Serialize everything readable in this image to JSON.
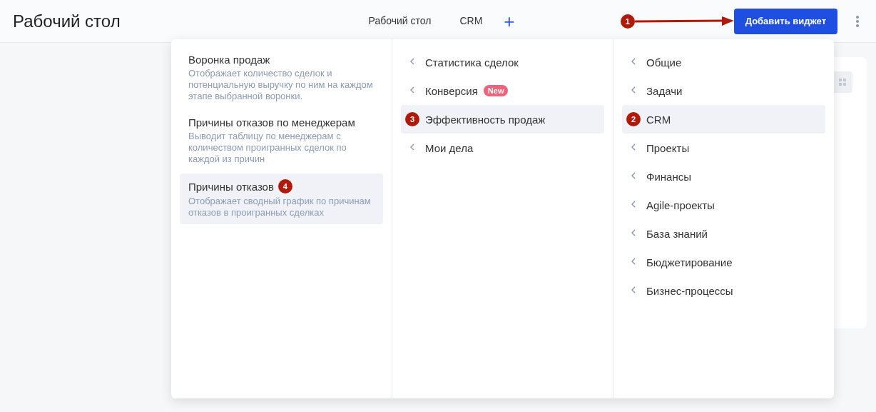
{
  "header": {
    "title": "Рабочий стол",
    "tabs": [
      {
        "label": "Рабочий стол",
        "selected": false
      },
      {
        "label": "CRM",
        "selected": false
      }
    ],
    "add_tab": "+",
    "step_marker": "1",
    "add_widget_button": "Добавить виджет"
  },
  "menu": {
    "widgets": [
      {
        "title": "Воронка продаж",
        "description": "Отображает количество сделок и потенциальную выручку по ним на каждом этапе выбранной воронки.",
        "selected": false
      },
      {
        "title": "Причины отказов по менеджерам",
        "description": "Выводит таблицу по менеджерам с количеством проигранных сделок по каждой из причин",
        "selected": false
      },
      {
        "title": "Причины отказов",
        "description": "Отображает сводный график по причинам отказов в проигранных сделках",
        "selected": true,
        "step_marker": "4"
      }
    ],
    "sections": [
      {
        "label": "Статистика сделок",
        "selected": false
      },
      {
        "label": "Конверсия",
        "selected": false,
        "badge": "New"
      },
      {
        "label": "Эффективность продаж",
        "selected": true,
        "step_marker": "3"
      },
      {
        "label": "Мои дела",
        "selected": false
      }
    ],
    "categories": [
      {
        "label": "Общие",
        "selected": false
      },
      {
        "label": "Задачи",
        "selected": false
      },
      {
        "label": "CRM",
        "selected": true,
        "step_marker": "2"
      },
      {
        "label": "Проекты",
        "selected": false
      },
      {
        "label": "Финансы",
        "selected": false
      },
      {
        "label": "Agile-проекты",
        "selected": false
      },
      {
        "label": "База знаний",
        "selected": false
      },
      {
        "label": "Бюджетирование",
        "selected": false
      },
      {
        "label": "Бизнес-процессы",
        "selected": false
      }
    ]
  }
}
